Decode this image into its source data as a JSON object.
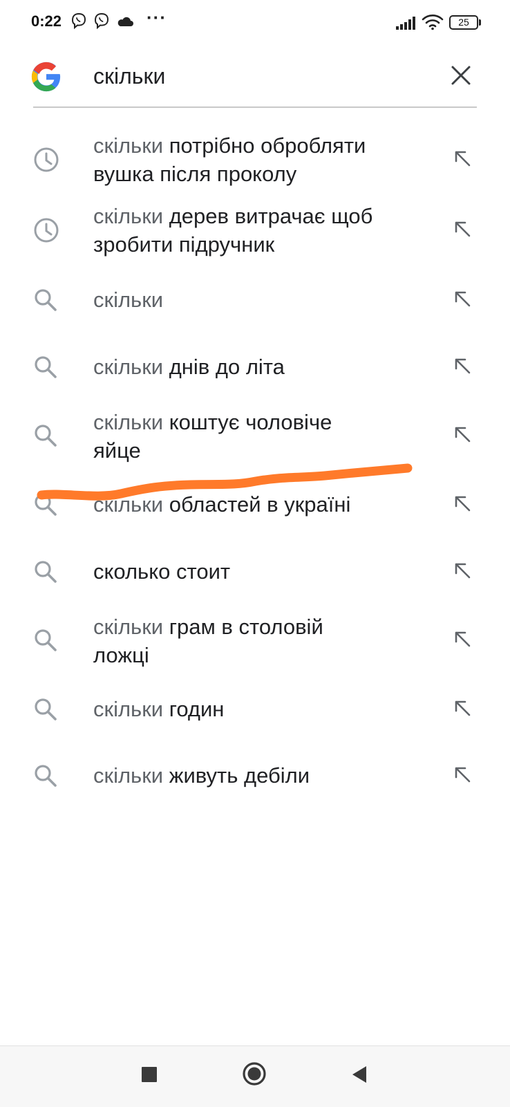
{
  "status_bar": {
    "time": "0:22",
    "icons": [
      "viber-icon",
      "viber-icon",
      "cloud-icon",
      "more-dots-icon",
      "signal-icon",
      "wifi-icon",
      "battery-icon"
    ],
    "more": "···",
    "battery_level": "25"
  },
  "search": {
    "query": "скільки",
    "clear_icon": "close-icon",
    "logo": "google-logo"
  },
  "suggestions": [
    {
      "icon": "history-icon",
      "prefix": "скільки",
      "rest": " потрібно обробляти вушка після проколу",
      "line1_rest": "потрібно обробляти",
      "line2": "вушка після проколу"
    },
    {
      "icon": "history-icon",
      "prefix": "скільки",
      "line1_rest": "дерев витрачає щоб",
      "line2": "зробити підручник"
    },
    {
      "icon": "search-icon",
      "prefix": "скільки",
      "line1_rest": "",
      "line2": ""
    },
    {
      "icon": "search-icon",
      "prefix": "скільки",
      "line1_rest": "днів до літа",
      "line2": ""
    },
    {
      "icon": "search-icon",
      "prefix": "скільки",
      "line1_rest": "коштує чоловіче",
      "line2": "яйце"
    },
    {
      "icon": "search-icon",
      "prefix": "скільки",
      "line1_rest": "областей в україні",
      "line2": ""
    },
    {
      "icon": "search-icon",
      "prefix": "",
      "line1_rest": "сколько стоит",
      "line2": ""
    },
    {
      "icon": "search-icon",
      "prefix": "скільки",
      "line1_rest": "грам в столовій",
      "line2": "ложці"
    },
    {
      "icon": "search-icon",
      "prefix": "скільки",
      "line1_rest": "годин",
      "line2": ""
    },
    {
      "icon": "search-icon",
      "prefix": "скільки",
      "line1_rest": "живуть дебіли",
      "line2": ""
    }
  ],
  "annotation": {
    "color": "#ff7a2a",
    "type": "hand-drawn underline"
  },
  "nav_bar": {
    "buttons": [
      "recents-square-icon",
      "home-circle-icon",
      "back-triangle-icon"
    ]
  },
  "colors": {
    "prefix_gray": "#5f6368",
    "text": "#202124",
    "icon_gray": "#9aa0a6"
  }
}
